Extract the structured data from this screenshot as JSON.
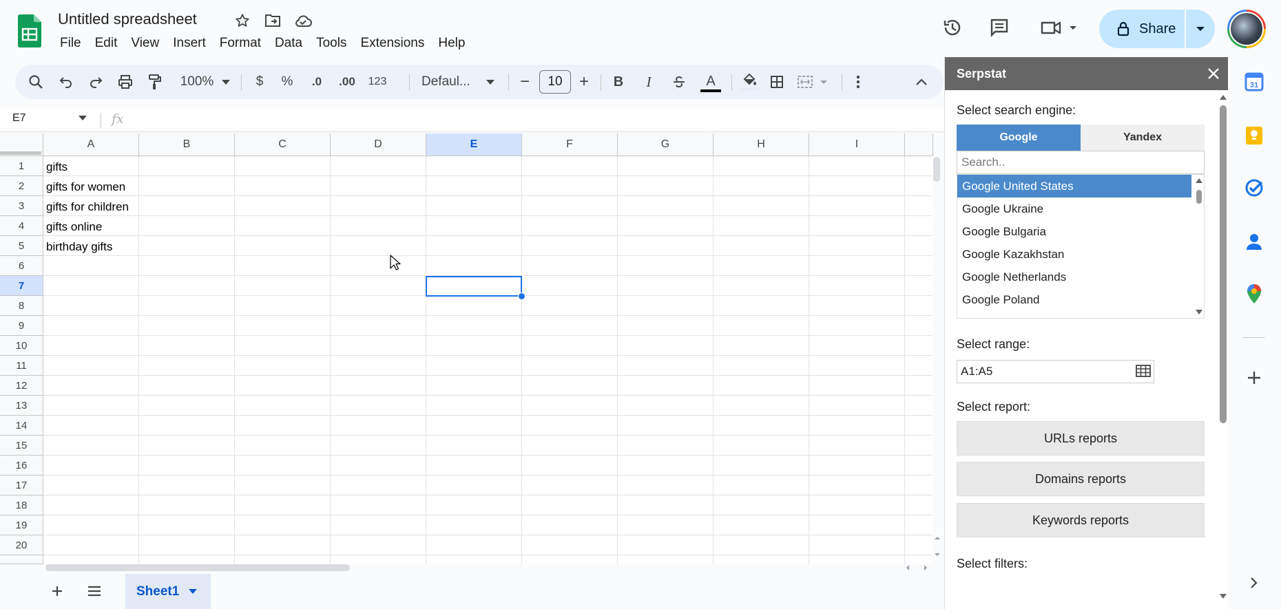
{
  "header": {
    "doc_title": "Untitled spreadsheet",
    "menus": [
      "File",
      "Edit",
      "View",
      "Insert",
      "Format",
      "Data",
      "Tools",
      "Extensions",
      "Help"
    ],
    "share_label": "Share",
    "icons": [
      "sheets-logo-icon",
      "star-icon",
      "move-folder-icon",
      "cloud-saved-icon",
      "history-icon",
      "comment-icon",
      "meet-icon",
      "lock-icon"
    ]
  },
  "toolbar": {
    "zoom": "100%",
    "currency": "$",
    "percent": "%",
    "dec_decrease": ".0",
    "dec_increase": ".00",
    "number_format": "123",
    "font": "Defaul...",
    "font_size": "10",
    "minus": "−",
    "plus": "+",
    "bold": "B",
    "italic": "I",
    "text_color": "A"
  },
  "formula_bar": {
    "name_box": "E7",
    "fx": "fx"
  },
  "grid": {
    "columns": [
      "A",
      "B",
      "C",
      "D",
      "E",
      "F",
      "G",
      "H",
      "I"
    ],
    "selected_column": "E",
    "rows": [
      "1",
      "2",
      "3",
      "4",
      "5",
      "6",
      "7",
      "8",
      "9",
      "10",
      "11",
      "12",
      "13",
      "14",
      "15",
      "16",
      "17",
      "18",
      "19",
      "20"
    ],
    "selected_row": "7",
    "cells_A": [
      "gifts",
      "gifts for women",
      "gifts for children",
      "gifts online",
      "birthday gifts"
    ]
  },
  "sheets": {
    "active": "Sheet1"
  },
  "panel": {
    "title": "Serpstat",
    "engine_label": "Select search engine:",
    "engine_tabs": [
      "Google",
      "Yandex"
    ],
    "search_placeholder": "Search..",
    "engines": [
      "Google United States",
      "Google Ukraine",
      "Google Bulgaria",
      "Google Kazakhstan",
      "Google Netherlands",
      "Google Poland"
    ],
    "range_label": "Select range:",
    "range_value": "A1:A5",
    "report_label": "Select report:",
    "reports": [
      "URLs reports",
      "Domains reports",
      "Keywords reports"
    ],
    "filters_label": "Select filters:"
  },
  "colors": {
    "accent": "#0b57d0",
    "share_bg": "#c2e7ff",
    "panel_header": "#666666",
    "panel_selected": "#4a8acb"
  }
}
